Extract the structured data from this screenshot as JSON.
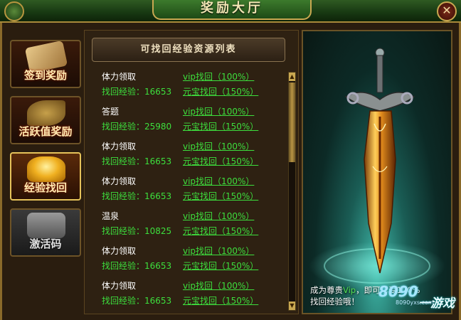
{
  "window": {
    "title": "奖励大厅",
    "close_symbol": "✕"
  },
  "sidebar": {
    "items": [
      {
        "label": "签到奖励",
        "icon": "scroll-icon",
        "active": false
      },
      {
        "label": "活跃值奖励",
        "icon": "leaf-icon",
        "active": false
      },
      {
        "label": "经验找回",
        "icon": "gold-ingot-icon",
        "active": true
      },
      {
        "label": "激活码",
        "icon": "gift-pack-icon",
        "active": false
      }
    ]
  },
  "list": {
    "header": "可找回经验资源列表",
    "rows": [
      {
        "name": "体力领取",
        "exp": "找回经验：16653",
        "vip": "vip找回（100%）",
        "gold": "元宝找回（150%）"
      },
      {
        "name": "答题",
        "exp": "找回经验：25980",
        "vip": "vip找回（100%）",
        "gold": "元宝找回（150%）"
      },
      {
        "name": "体力领取",
        "exp": "找回经验：16653",
        "vip": "vip找回（100%）",
        "gold": "元宝找回（150%）"
      },
      {
        "name": "体力领取",
        "exp": "找回经验：16653",
        "vip": "vip找回（100%）",
        "gold": "元宝找回（150%）"
      },
      {
        "name": "温泉",
        "exp": "找回经验：10825",
        "vip": "vip找回（100%）",
        "gold": "元宝找回（150%）"
      },
      {
        "name": "体力领取",
        "exp": "找回经验：16653",
        "vip": "vip找回（100%）",
        "gold": "元宝找回（150%）"
      },
      {
        "name": "体力领取",
        "exp": "找回经验：16653",
        "vip": "vip找回（100%）",
        "gold": "元宝找回（150%）"
      }
    ]
  },
  "promo": {
    "line1_a": "成为尊贵",
    "line1_vip": "Vip",
    "line1_b": "，即可享受100%",
    "line2": "找回经验哦！"
  },
  "watermark": {
    "number": "8090",
    "site": "8090yxs.com",
    "game": "一游戏"
  },
  "colors": {
    "exp_green": "#3ddf3d",
    "title_gold": "#f3e6b4",
    "active_border": "#e6c35a"
  }
}
